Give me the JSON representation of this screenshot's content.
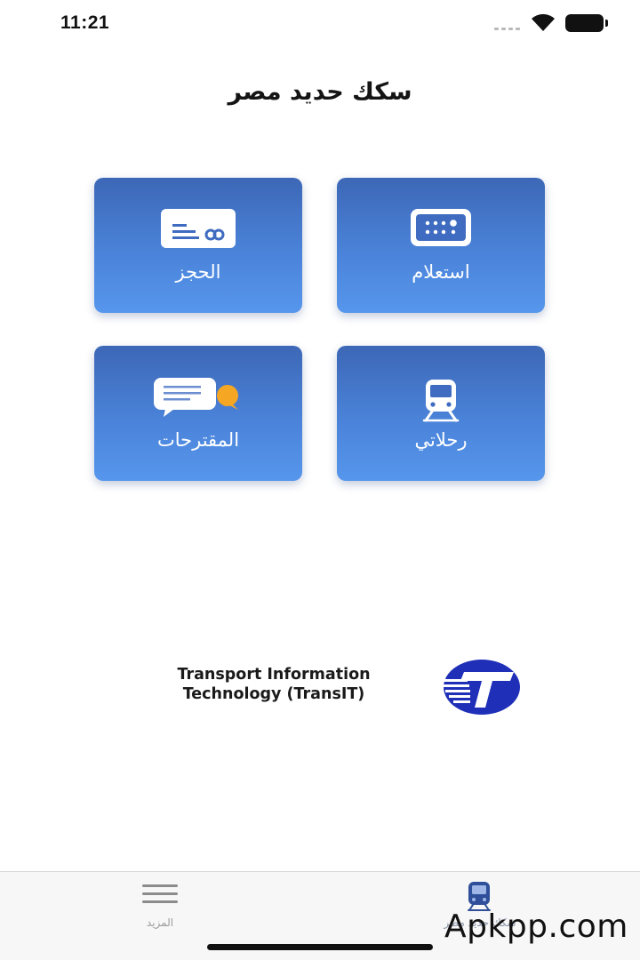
{
  "status_bar": {
    "time": "11:21",
    "icons": [
      "signal-icon",
      "wifi-icon",
      "battery-icon"
    ]
  },
  "header": {
    "title": "سكك حديد مصر"
  },
  "tiles": [
    {
      "label": "استعلام",
      "icon": "timetable-board-icon"
    },
    {
      "label": "الحجز",
      "icon": "ticket-card-icon"
    },
    {
      "label": "رحلاتي",
      "icon": "train-icon"
    },
    {
      "label": "المقترحات",
      "icon": "chat-bubbles-icon"
    }
  ],
  "footer": {
    "company_line1": "Transport Information",
    "company_line2": "Technology (TransIT)",
    "logo_icon": "transit-logo"
  },
  "tab_bar": {
    "tabs": [
      {
        "label": "المزيد",
        "icon": "menu-icon"
      },
      {
        "label": "سكك حديد مصر",
        "icon": "train-icon",
        "active": true
      }
    ]
  },
  "watermark": "Apkpp.com",
  "colors": {
    "tile_top": "#3d67b6",
    "tile_bottom": "#5696ec",
    "chat_accent": "#f5a623",
    "logo_blue": "#1f2fb8"
  }
}
